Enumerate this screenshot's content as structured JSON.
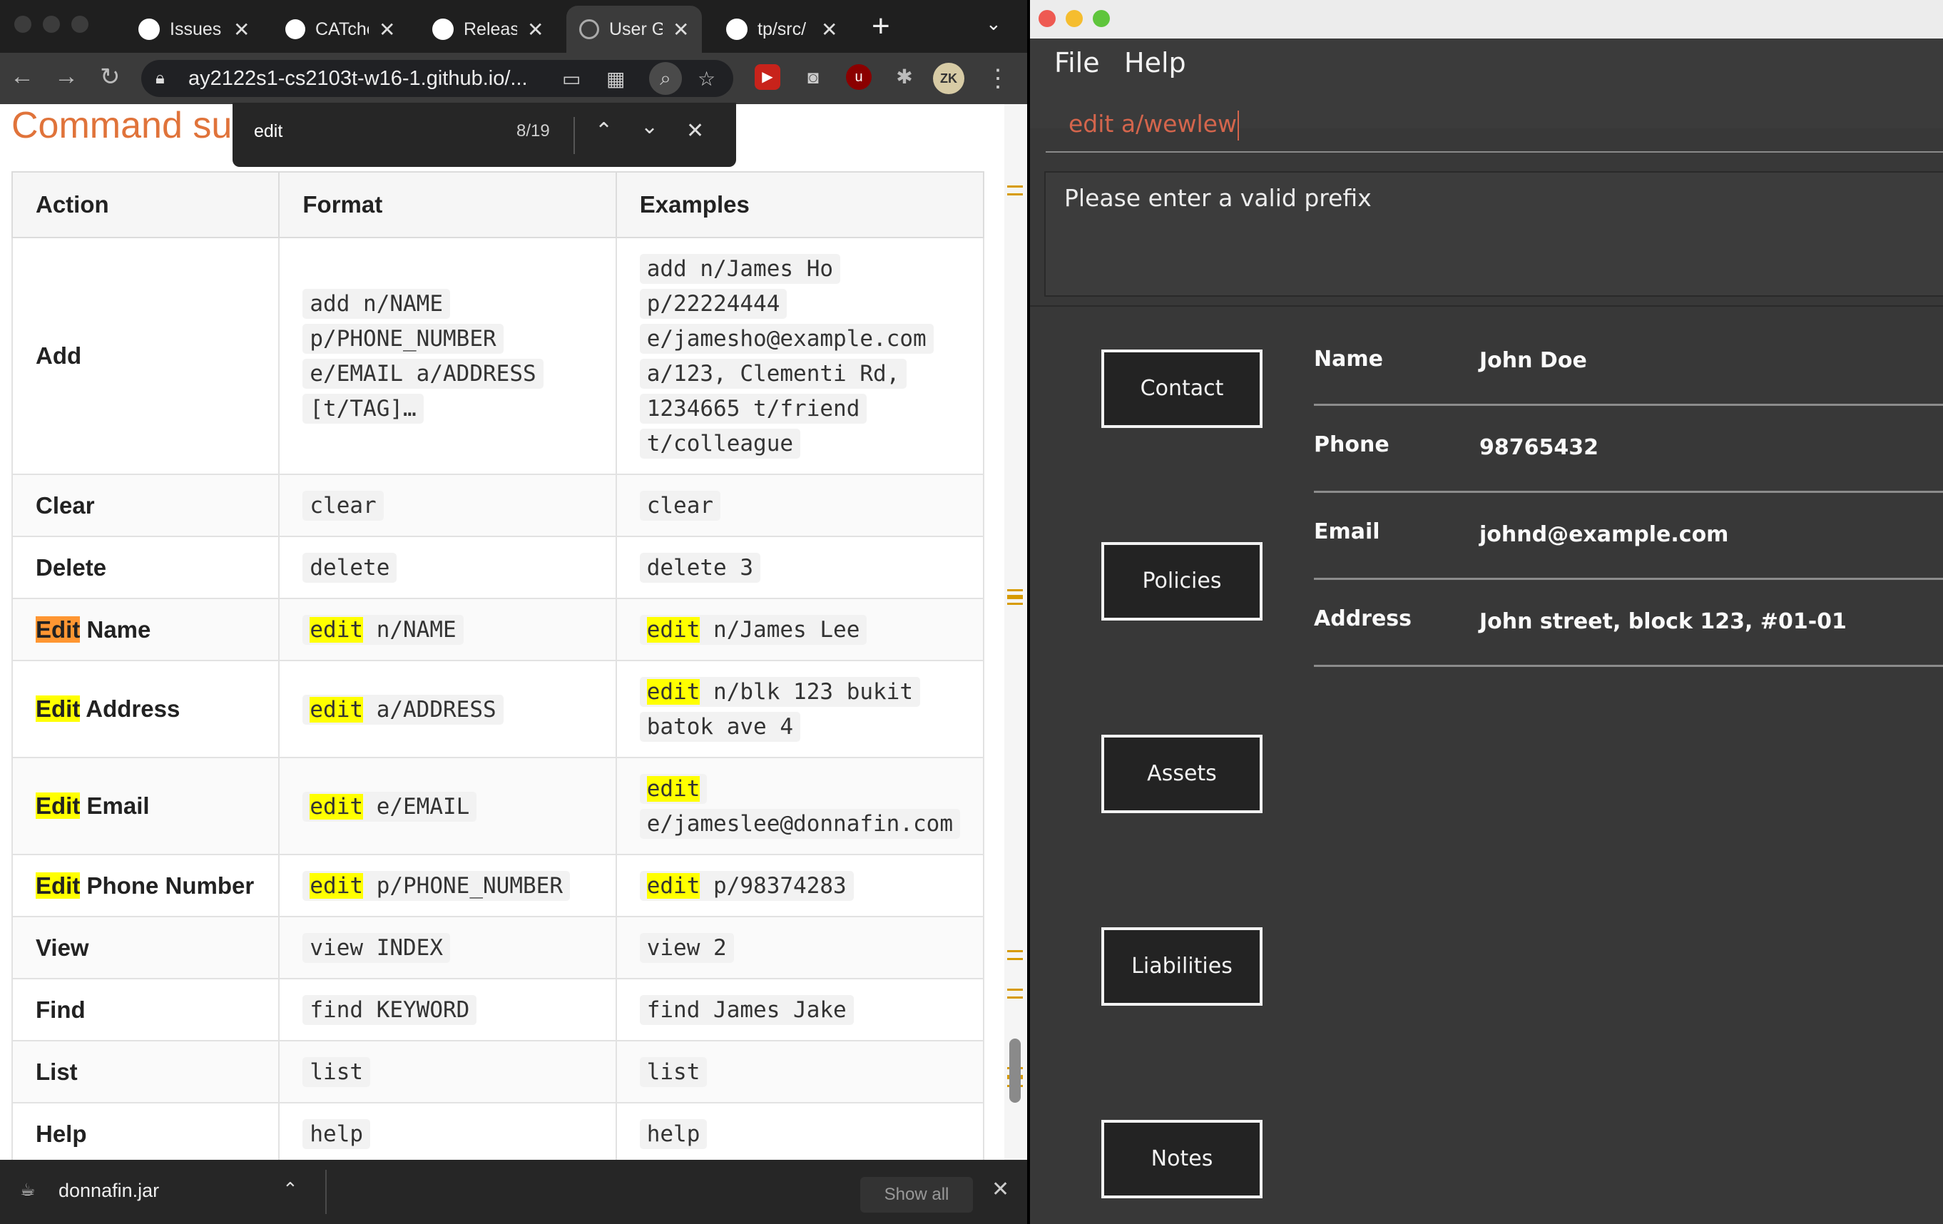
{
  "browser": {
    "tabs": [
      {
        "title": "Issues",
        "icon": "github-icon"
      },
      {
        "title": "CATche",
        "icon": "catcher-icon"
      },
      {
        "title": "Releas",
        "icon": "github-icon"
      },
      {
        "title": "User G",
        "icon": "globe-icon",
        "active": true
      },
      {
        "title": "tp/src/",
        "icon": "github-icon"
      }
    ],
    "new_tab": "+",
    "url": "ay2122s1-cs2103t-w16-1.github.io/...",
    "find": {
      "query": "edit",
      "count": "8/19"
    },
    "profile_initials": "ZK"
  },
  "page": {
    "heading": "Command su",
    "table": {
      "headers": [
        "Action",
        "Format",
        "Examples"
      ],
      "rows": [
        {
          "action": [
            {
              "t": "Add"
            }
          ],
          "format": [
            {
              "t": "add n/NAME p/PHONE_NUMBER e/EMAIL a/ADDRESS [t/TAG]…"
            }
          ],
          "example": [
            {
              "t": "add n/James Ho p/22224444 e/jamesho@example.com a/123, Clementi Rd, 1234665 t/friend t/colleague"
            }
          ]
        },
        {
          "action": [
            {
              "t": "Clear"
            }
          ],
          "format": [
            {
              "t": "clear"
            }
          ],
          "example": [
            {
              "t": "clear"
            }
          ]
        },
        {
          "action": [
            {
              "t": "Delete"
            }
          ],
          "format": [
            {
              "t": "delete"
            }
          ],
          "example": [
            {
              "t": "delete 3"
            }
          ]
        },
        {
          "action": [
            {
              "t": "Edit",
              "hl": "current"
            },
            {
              "t": " Name"
            }
          ],
          "format": [
            {
              "t": "edit",
              "hl": "match"
            },
            {
              "t": " n/NAME"
            }
          ],
          "example": [
            {
              "t": "edit",
              "hl": "match"
            },
            {
              "t": " n/James Lee"
            }
          ]
        },
        {
          "action": [
            {
              "t": "Edit",
              "hl": "match"
            },
            {
              "t": " Address"
            }
          ],
          "format": [
            {
              "t": "edit",
              "hl": "match"
            },
            {
              "t": " a/ADDRESS"
            }
          ],
          "example": [
            {
              "t": "edit",
              "hl": "match"
            },
            {
              "t": " n/blk 123 bukit batok ave 4"
            }
          ]
        },
        {
          "action": [
            {
              "t": "Edit",
              "hl": "match"
            },
            {
              "t": " Email"
            }
          ],
          "format": [
            {
              "t": "edit",
              "hl": "match"
            },
            {
              "t": " e/EMAIL"
            }
          ],
          "example": [
            {
              "t": "edit",
              "hl": "match"
            },
            {
              "t": " e/jameslee@donnafin.com"
            }
          ]
        },
        {
          "action": [
            {
              "t": "Edit",
              "hl": "match"
            },
            {
              "t": " Phone Number"
            }
          ],
          "format": [
            {
              "t": "edit",
              "hl": "match"
            },
            {
              "t": " p/PHONE_NUMBER"
            }
          ],
          "example": [
            {
              "t": "edit",
              "hl": "match"
            },
            {
              "t": " p/98374283"
            }
          ]
        },
        {
          "action": [
            {
              "t": "View"
            }
          ],
          "format": [
            {
              "t": "view INDEX"
            }
          ],
          "example": [
            {
              "t": "view 2"
            }
          ]
        },
        {
          "action": [
            {
              "t": "Find"
            }
          ],
          "format": [
            {
              "t": "find KEYWORD"
            }
          ],
          "example": [
            {
              "t": "find James Jake"
            }
          ]
        },
        {
          "action": [
            {
              "t": "List"
            }
          ],
          "format": [
            {
              "t": "list"
            }
          ],
          "example": [
            {
              "t": "list"
            }
          ]
        },
        {
          "action": [
            {
              "t": "Help"
            }
          ],
          "format": [
            {
              "t": "help"
            }
          ],
          "example": [
            {
              "t": "help"
            }
          ]
        }
      ]
    }
  },
  "downloads": {
    "file": "donnafin.jar",
    "show_all": "Show all"
  },
  "app": {
    "menu": [
      "File",
      "Help"
    ],
    "command": "edit a/wewlew",
    "result": "Please enter a valid prefix",
    "tabs": [
      "Contact",
      "Policies",
      "Assets",
      "Liabilities",
      "Notes"
    ],
    "details": [
      {
        "label": "Name",
        "value": "John Doe"
      },
      {
        "label": "Phone",
        "value": "98765432"
      },
      {
        "label": "Email",
        "value": "johnd@example.com"
      },
      {
        "label": "Address",
        "value": "John street, block 123, #01-01"
      }
    ]
  },
  "colors": {
    "highlight": "#ffff00",
    "current_highlight": "#ff9632",
    "heading": "#e0733a",
    "command_text": "#d4654c"
  }
}
